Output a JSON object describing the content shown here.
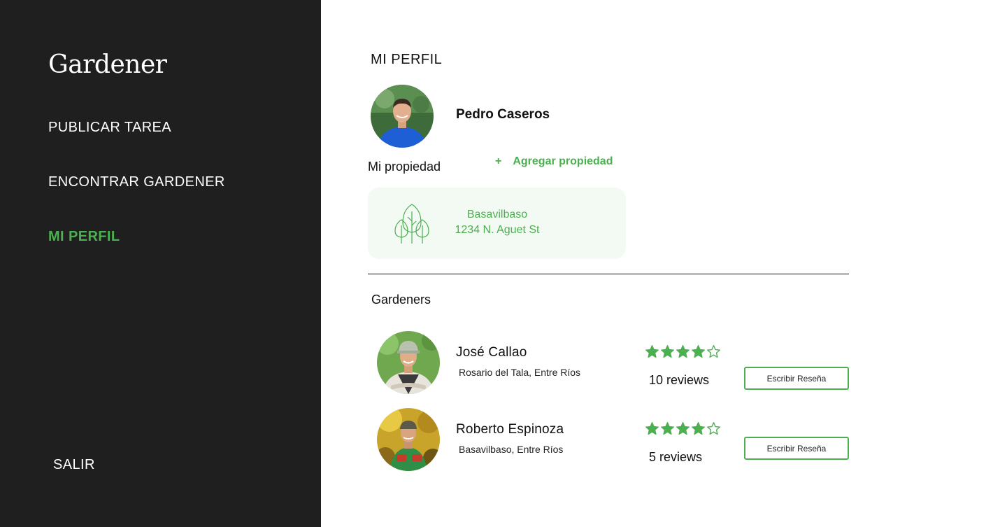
{
  "app": {
    "logo": "Gardener"
  },
  "sidebar": {
    "items": [
      {
        "label": "PUBLICAR TAREA",
        "active": false
      },
      {
        "label": "ENCONTRAR GARDENER",
        "active": false
      },
      {
        "label": "MI PERFIL",
        "active": true
      }
    ],
    "logout_label": "SALIR"
  },
  "profile": {
    "page_title": "MI PERFIL",
    "name": "Pedro Caseros",
    "avatar_icon": "user-avatar-photo"
  },
  "property": {
    "label": "Mi propiedad",
    "add_icon": "plus-icon",
    "add_label": "Agregar propiedad",
    "card": {
      "icon": "trees-icon",
      "city": "Basavilbaso",
      "address": "1234 N. Aguet St"
    }
  },
  "gardeners": {
    "title": "Gardeners",
    "items": [
      {
        "name": "José Callao",
        "location": "Rosario del Tala, Entre Ríos",
        "rating": 4,
        "max_rating": 5,
        "reviews": "10 reviews",
        "action": "Escribir Reseña"
      },
      {
        "name": "Roberto Espinoza",
        "location": "Basavilbaso, Entre Ríos",
        "rating": 4,
        "max_rating": 5,
        "reviews": "5 reviews",
        "action": "Escribir Reseña"
      }
    ]
  },
  "colors": {
    "accent": "#4caf50",
    "sidebar_bg": "#1f1f1f",
    "card_bg": "#f2faf3"
  }
}
